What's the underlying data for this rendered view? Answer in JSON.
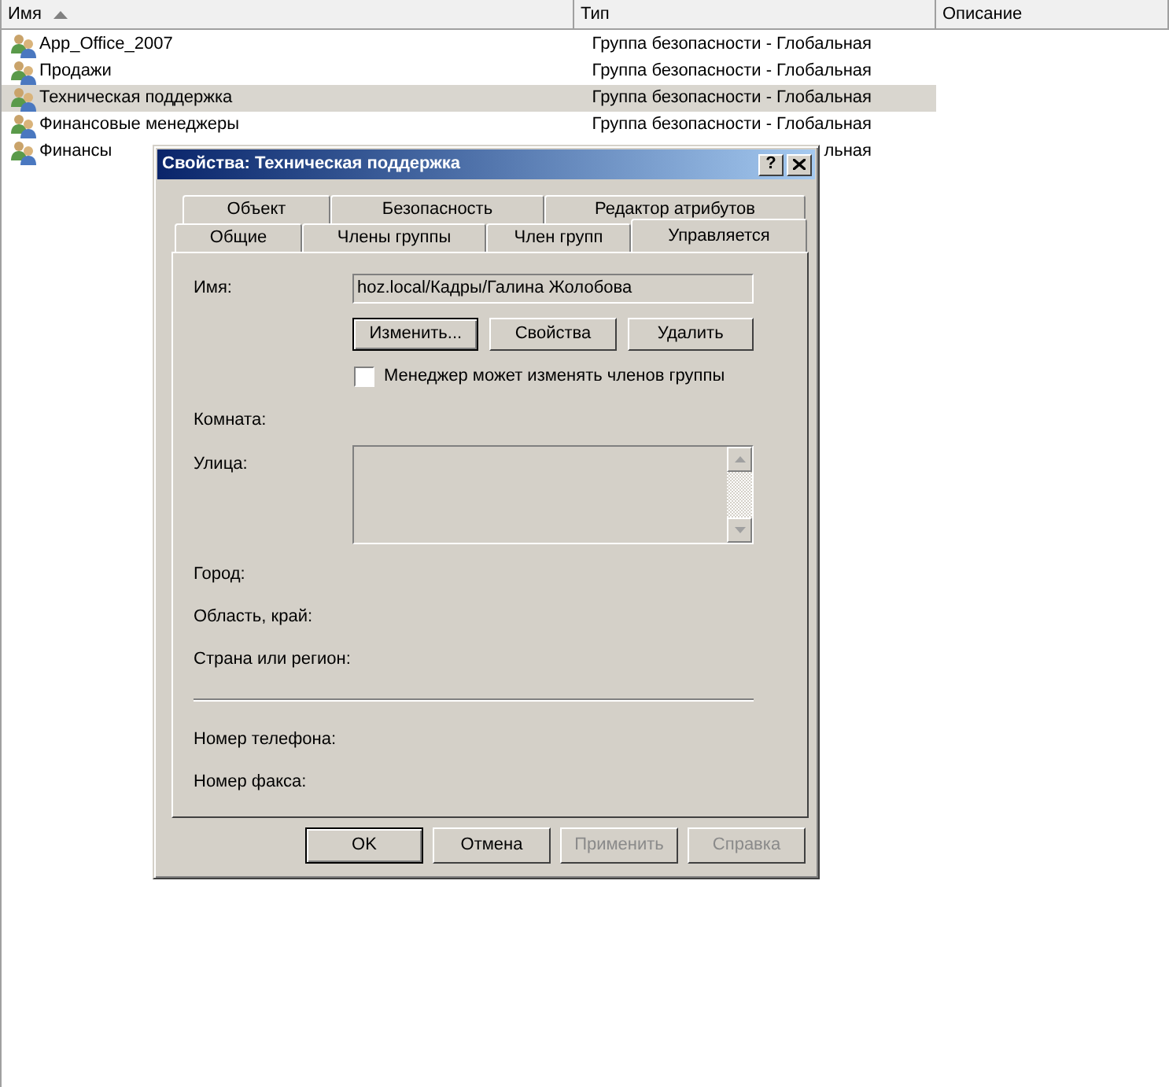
{
  "list": {
    "columns": [
      {
        "label": "Имя",
        "sorted": true
      },
      {
        "label": "Тип",
        "sorted": false
      },
      {
        "label": "Описание",
        "sorted": false
      }
    ],
    "rows": [
      {
        "name": "App_Office_2007",
        "type": "Группа безопасности - Глобальная",
        "selected": false
      },
      {
        "name": "Продажи",
        "type": "Группа безопасности - Глобальная",
        "selected": false
      },
      {
        "name": "Техническая поддержка",
        "type": "Группа безопасности - Глобальная",
        "selected": true
      },
      {
        "name": "Финансовые менеджеры",
        "type": "Группа безопасности - Глобальная",
        "selected": false
      },
      {
        "name": "Финансы",
        "type": "льная",
        "selected": false
      }
    ]
  },
  "dialog": {
    "title": "Свойства: Техническая поддержка",
    "help_button": "?",
    "tab_rows": [
      [
        {
          "label": "Объект",
          "selected": false
        },
        {
          "label": "Безопасность",
          "selected": false
        },
        {
          "label": "Редактор атрибутов",
          "selected": false
        }
      ],
      [
        {
          "label": "Общие",
          "selected": false
        },
        {
          "label": "Члены группы",
          "selected": false
        },
        {
          "label": "Член групп",
          "selected": false
        },
        {
          "label": "Управляется",
          "selected": true
        }
      ]
    ],
    "name_label": "Имя:",
    "name_value": "hoz.local/Кадры/Галина Жолобова",
    "buttons": [
      {
        "label": "Изменить...",
        "focused": true
      },
      {
        "label": "Свойства",
        "focused": false
      },
      {
        "label": "Удалить",
        "focused": false
      }
    ],
    "checkbox": {
      "label": "Менеджер может изменять членов группы",
      "checked": false
    },
    "fields": [
      {
        "kind": "line",
        "label": "Комната:"
      },
      {
        "kind": "multiline",
        "label": "Улица:"
      },
      {
        "kind": "line",
        "label": "Город:"
      },
      {
        "kind": "line",
        "label": "Область, край:"
      },
      {
        "kind": "line",
        "label": "Страна или регион:"
      },
      {
        "kind": "separator"
      },
      {
        "kind": "line",
        "label": "Номер телефона:"
      },
      {
        "kind": "line",
        "label": "Номер факса:"
      }
    ],
    "footer_buttons": [
      {
        "label": "OK",
        "default": true,
        "disabled": false
      },
      {
        "label": "Отмена",
        "default": false,
        "disabled": false
      },
      {
        "label": "Применить",
        "default": false,
        "disabled": true
      },
      {
        "label": "Справка",
        "default": false,
        "disabled": true
      }
    ]
  }
}
